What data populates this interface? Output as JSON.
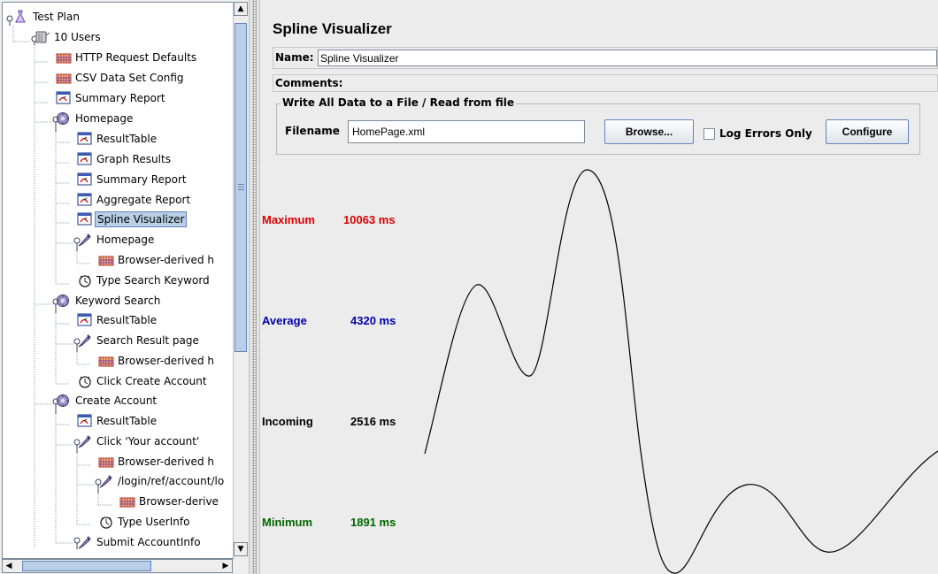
{
  "tree": {
    "nodes": [
      {
        "label": "Test Plan",
        "icon": "test-plan-icon"
      },
      {
        "label": "10 Users",
        "icon": "thread-group-icon"
      },
      {
        "label": "HTTP Request Defaults",
        "icon": "config-element-icon"
      },
      {
        "label": "CSV Data Set Config",
        "icon": "config-element-icon"
      },
      {
        "label": "Summary Report",
        "icon": "listener-icon"
      },
      {
        "label": "Homepage",
        "icon": "transaction-controller-icon"
      },
      {
        "label": "ResultTable",
        "icon": "listener-icon"
      },
      {
        "label": "Graph Results",
        "icon": "listener-icon"
      },
      {
        "label": "Summary Report",
        "icon": "listener-icon"
      },
      {
        "label": "Aggregate Report",
        "icon": "listener-icon"
      },
      {
        "label": "Spline Visualizer",
        "icon": "listener-icon",
        "selected": true
      },
      {
        "label": "Homepage",
        "icon": "sampler-icon"
      },
      {
        "label": "Browser-derived h",
        "icon": "config-element-icon"
      },
      {
        "label": "Type Search Keyword",
        "icon": "timer-icon"
      },
      {
        "label": "Keyword Search",
        "icon": "transaction-controller-icon"
      },
      {
        "label": "ResultTable",
        "icon": "listener-icon"
      },
      {
        "label": "Search Result page",
        "icon": "sampler-icon"
      },
      {
        "label": "Browser-derived h",
        "icon": "config-element-icon"
      },
      {
        "label": "Click Create Account",
        "icon": "timer-icon"
      },
      {
        "label": "Create Account",
        "icon": "transaction-controller-icon"
      },
      {
        "label": "ResultTable",
        "icon": "listener-icon"
      },
      {
        "label": "Click 'Your account'",
        "icon": "sampler-icon"
      },
      {
        "label": "Browser-derived h",
        "icon": "config-element-icon"
      },
      {
        "label": "/login/ref/account/lo",
        "icon": "sampler-icon"
      },
      {
        "label": "Browser-derive",
        "icon": "config-element-icon"
      },
      {
        "label": "Type UserInfo",
        "icon": "timer-icon"
      },
      {
        "label": "Submit AccountInfo",
        "icon": "sampler-icon"
      }
    ]
  },
  "visualizer": {
    "title": "Spline Visualizer",
    "name_label": "Name:",
    "name_value": "Spline Visualizer",
    "comments_label": "Comments:",
    "file_legend": "Write All Data to a File / Read from file",
    "filename_label": "Filename",
    "filename_value": "HomePage.xml",
    "browse_label": "Browse...",
    "log_errors_label": "Log Errors Only",
    "log_errors_checked": false,
    "configure_label": "Configure"
  },
  "stats": {
    "maximum": {
      "label": "Maximum",
      "value": "10063 ms",
      "color": "#dd0000"
    },
    "average": {
      "label": "Average",
      "value": "4320 ms",
      "color": "#0000aa"
    },
    "incoming": {
      "label": "Incoming",
      "value": "2516 ms",
      "color": "#000000"
    },
    "minimum": {
      "label": "Minimum",
      "value": "1891 ms",
      "color": "#006600"
    }
  }
}
